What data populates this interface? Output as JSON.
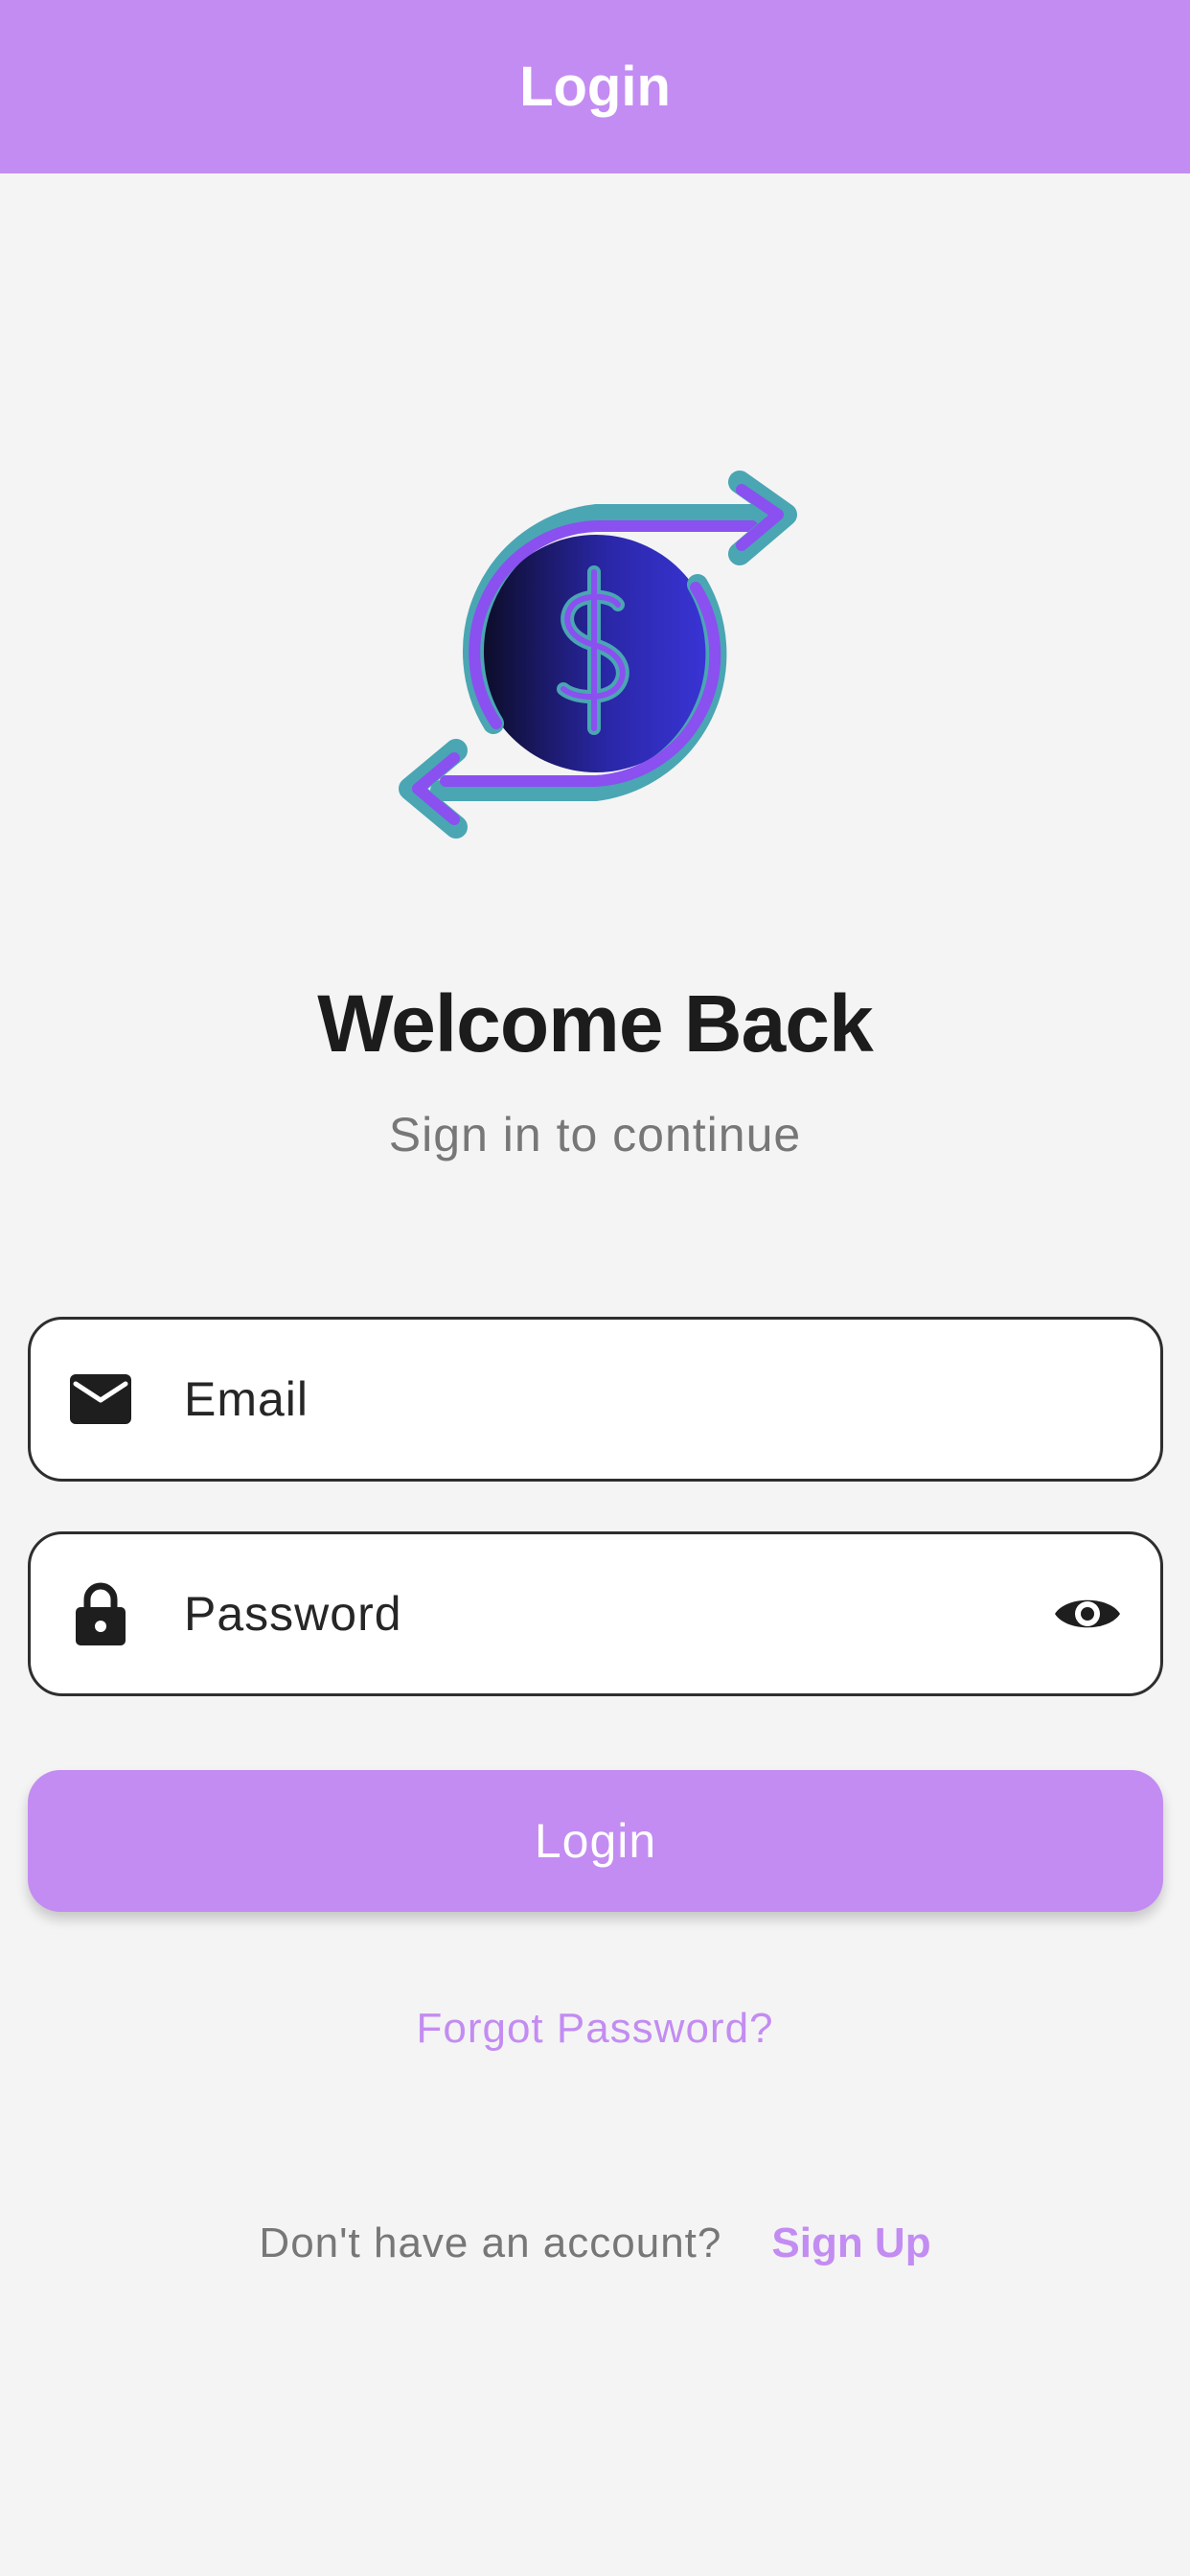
{
  "app_bar": {
    "title": "Login"
  },
  "welcome": {
    "title": "Welcome Back",
    "subtitle": "Sign in to continue"
  },
  "email_field": {
    "placeholder": "Email",
    "value": "",
    "icon": "mail-icon"
  },
  "password_field": {
    "placeholder": "Password",
    "value": "",
    "icon": "lock-icon",
    "toggle_icon": "eye-icon"
  },
  "login_button": {
    "label": "Login"
  },
  "forgot_password": {
    "label": "Forgot Password?"
  },
  "signup": {
    "prompt": "Don't have an account?",
    "link_label": "Sign Up"
  },
  "colors": {
    "accent": "#c38cf2",
    "background": "#f4f4f4",
    "text_primary": "#1c1c1c",
    "text_secondary": "#777777",
    "logo_teal": "#4aa6b3",
    "logo_purple": "#8a50f0",
    "logo_coin_dark": "#0b0b23",
    "logo_coin_blue": "#3a35d8"
  }
}
